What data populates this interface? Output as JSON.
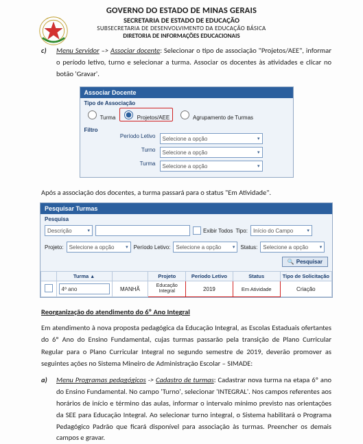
{
  "header": {
    "l1": "GOVERNO DO ESTADO DE MINAS GERAIS",
    "l2": "SECRETARIA DE ESTADO DE EDUCAÇÃO",
    "l3": "SUBSECRETARIA DE DESENVOLVIMENTO DA EDUCAÇÃO BÁSICA",
    "l4": "DIRETORIA DE INFORMAÇÕES EDUCACIONAIS"
  },
  "item_c": {
    "letter": "c)",
    "lead1": "Menu Servidor",
    "arrow": " –> ",
    "lead2": "Associar docente",
    "rest": ": Selecionar o tipo de associação \"Projetos/AEE\", informar o período letivo, turno e selecionar a turma. Associar os docentes às atividades e clicar no botão 'Gravar'."
  },
  "assoc": {
    "title": "Associar Docente",
    "section_tipo": "Tipo de Associação",
    "radio_turma": "Turma",
    "radio_proj": "Projetos/AEE",
    "radio_agrup": "Agrupamento de Turmas",
    "section_filtro": "Filtro",
    "labels": {
      "periodo": "Período Letivo",
      "turno": "Turno",
      "turma": "Turma"
    },
    "placeholder": "Selecione a opção"
  },
  "between": "Após a associação dos docentes, a turma passará para o status \"Em Atividade\".",
  "pesq": {
    "title": "Pesquisar Turmas",
    "section": "Pesquisa",
    "descricao": "Descrição",
    "exibir": "Exibir Todos",
    "tipo": "Tipo:",
    "tipo_val": "Início do Campo",
    "projeto": "Projeto:",
    "periodo": "Período Letivo:",
    "status": "Status:",
    "sel_placeholder": "Selecione a opção",
    "btn": "Pesquisar",
    "th": {
      "turma": "Turma",
      "turno": "",
      "projeto": "Projeto",
      "periodo": "Período Letivo",
      "status": "Status",
      "tipo_solic": "Tipo de Solicitação"
    },
    "row": {
      "turma": "4º ano",
      "turno": "MANHÃ",
      "projeto": "Educação Integral",
      "periodo": "2019",
      "status": "Em Atividade",
      "tipo_solic": "Criação"
    }
  },
  "reorg_title": "Reorganização do atendimento do 6º Ano Integral",
  "para1": "Em atendimento à nova proposta pedagógica da Educação Integral, as Escolas Estaduais ofertantes do 6º Ano do Ensino Fundamental, cujas turmas passarão pela transição de Plano Curricular Regular para o Plano Curricular Integral no segundo semestre de 2019, deverão promover as seguintes ações no Sistema Mineiro de Administração Escolar – SIMADE:",
  "item_a": {
    "letter": "a)",
    "lead1": "Menu Programas pedagógicos",
    "arrow": " -> ",
    "lead2": "Cadastro de turmas",
    "rest": ": Cadastrar nova turma na etapa 6º ano do Ensino Fundamental. No campo 'Turno', selecionar 'INTEGRAL'. Nos campos referentes aos horários de início e término das aulas, informar o intervalo mínimo previsto nas orientações da SEE para Educação Integral. Ao selecionar turno integral, o Sistema habilitará o Programa Pedagógico Padrão que ficará disponível para associação às turmas. Preencher os demais campos e gravar."
  }
}
